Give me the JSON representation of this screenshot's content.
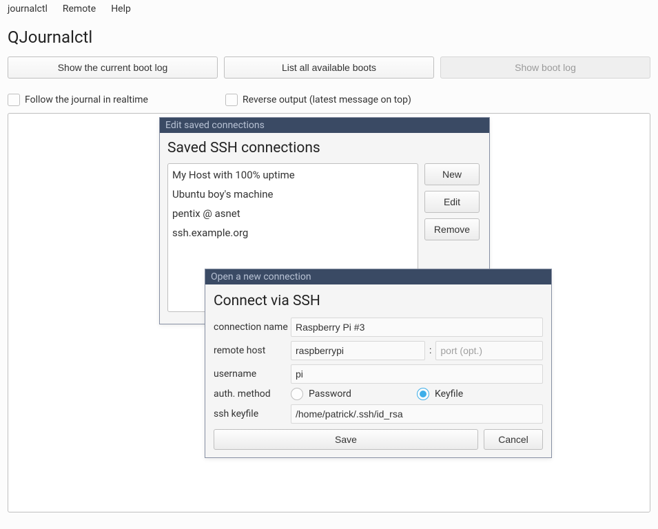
{
  "menubar": {
    "items": [
      "journalctl",
      "Remote",
      "Help"
    ]
  },
  "app_title": "QJournalctl",
  "toolbar": {
    "current_boot": "Show the current boot log",
    "list_boots": "List all available boots",
    "show_boot_log": "Show boot log"
  },
  "options": {
    "follow_realtime": "Follow the journal in realtime",
    "reverse_output": "Reverse output (latest message on top)"
  },
  "saved_dialog": {
    "title": "Edit saved connections",
    "heading": "Saved SSH connections",
    "items": [
      "My Host with 100% uptime",
      "Ubuntu boy's machine",
      "pentix @ asnet",
      "ssh.example.org"
    ],
    "buttons": {
      "new": "New",
      "edit": "Edit",
      "remove": "Remove"
    }
  },
  "conn_dialog": {
    "title": "Open a new connection",
    "heading": "Connect via SSH",
    "labels": {
      "connection_name": "connection name",
      "remote_host": "remote host",
      "username": "username",
      "auth_method": "auth. method",
      "ssh_keyfile": "ssh keyfile"
    },
    "values": {
      "connection_name": "Raspberry Pi #3",
      "remote_host": "raspberrypi",
      "port_placeholder": "port (opt.)",
      "username": "pi",
      "ssh_keyfile": "/home/patrick/.ssh/id_rsa"
    },
    "auth_options": {
      "password": "Password",
      "keyfile": "Keyfile"
    },
    "auth_selected": "keyfile",
    "buttons": {
      "save": "Save",
      "cancel": "Cancel"
    }
  }
}
